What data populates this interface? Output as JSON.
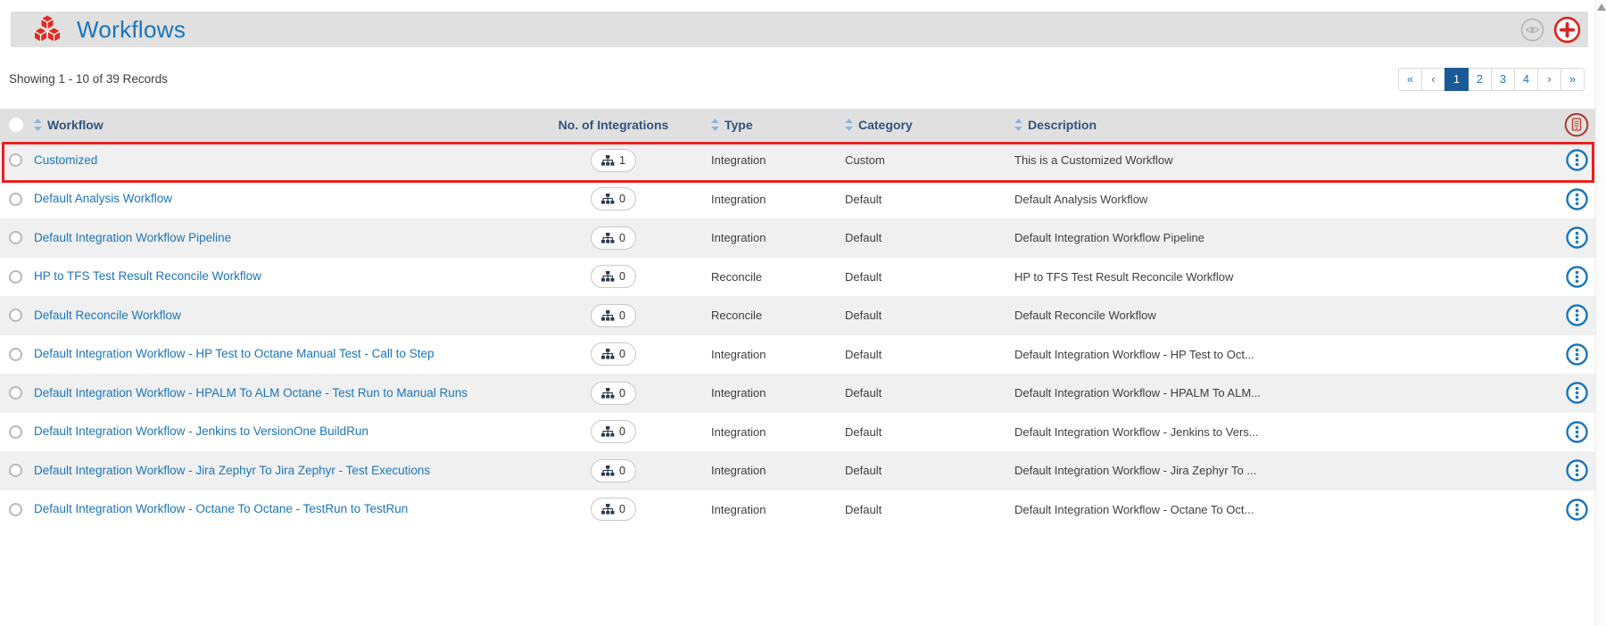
{
  "page": {
    "title": "Workflows",
    "title_icon": "workflow-cubes-icon",
    "actions": {
      "view_icon": "eye-icon",
      "add_icon": "plus-icon"
    }
  },
  "summary": {
    "text": "Showing 1 - 10 of 39 Records"
  },
  "pagination": {
    "buttons": [
      "«",
      "‹",
      "1",
      "2",
      "3",
      "4",
      "›",
      "»"
    ],
    "active": "1"
  },
  "table": {
    "headers": {
      "workflow": "Workflow",
      "integrations": "No. of Integrations",
      "type": "Type",
      "category": "Category",
      "description": "Description",
      "actions_icon": "report-icon"
    },
    "rows": [
      {
        "name": "Customized",
        "integrations": "1",
        "type": "Integration",
        "category": "Custom",
        "description": "This is a Customized Workflow",
        "highlighted": true
      },
      {
        "name": "Default Analysis Workflow",
        "integrations": "0",
        "type": "Integration",
        "category": "Default",
        "description": "Default Analysis Workflow",
        "highlighted": false
      },
      {
        "name": "Default Integration Workflow Pipeline",
        "integrations": "0",
        "type": "Integration",
        "category": "Default",
        "description": "Default Integration Workflow Pipeline",
        "highlighted": false
      },
      {
        "name": "HP to TFS Test Result Reconcile Workflow",
        "integrations": "0",
        "type": "Reconcile",
        "category": "Default",
        "description": "HP to TFS Test Result Reconcile Workflow",
        "highlighted": false
      },
      {
        "name": "Default Reconcile Workflow",
        "integrations": "0",
        "type": "Reconcile",
        "category": "Default",
        "description": "Default Reconcile Workflow",
        "highlighted": false
      },
      {
        "name": "Default Integration Workflow - HP Test to Octane Manual Test - Call to Step",
        "integrations": "0",
        "type": "Integration",
        "category": "Default",
        "description": "Default Integration Workflow - HP Test to Oct...",
        "highlighted": false
      },
      {
        "name": "Default Integration Workflow - HPALM To ALM Octane - Test Run to Manual Runs",
        "integrations": "0",
        "type": "Integration",
        "category": "Default",
        "description": "Default Integration Workflow - HPALM To ALM...",
        "highlighted": false
      },
      {
        "name": "Default Integration Workflow - Jenkins to VersionOne BuildRun",
        "integrations": "0",
        "type": "Integration",
        "category": "Default",
        "description": "Default Integration Workflow - Jenkins to Vers...",
        "highlighted": false
      },
      {
        "name": "Default Integration Workflow - Jira Zephyr To Jira Zephyr - Test Executions",
        "integrations": "0",
        "type": "Integration",
        "category": "Default",
        "description": "Default Integration Workflow - Jira Zephyr To ...",
        "highlighted": false
      },
      {
        "name": "Default Integration Workflow - Octane To Octane - TestRun to TestRun",
        "integrations": "0",
        "type": "Integration",
        "category": "Default",
        "description": "Default Integration Workflow - Octane To Oct...",
        "highlighted": false
      }
    ]
  },
  "colors": {
    "accent_blue": "#1b75bb",
    "header_text_navy": "#33527e",
    "active_page_bg": "#1a5a96",
    "brand_red": "#e32b24",
    "highlight_red": "#ec1f1f",
    "bar_gray": "#e0e0e0",
    "row_alt_gray": "#f0f0f0"
  }
}
